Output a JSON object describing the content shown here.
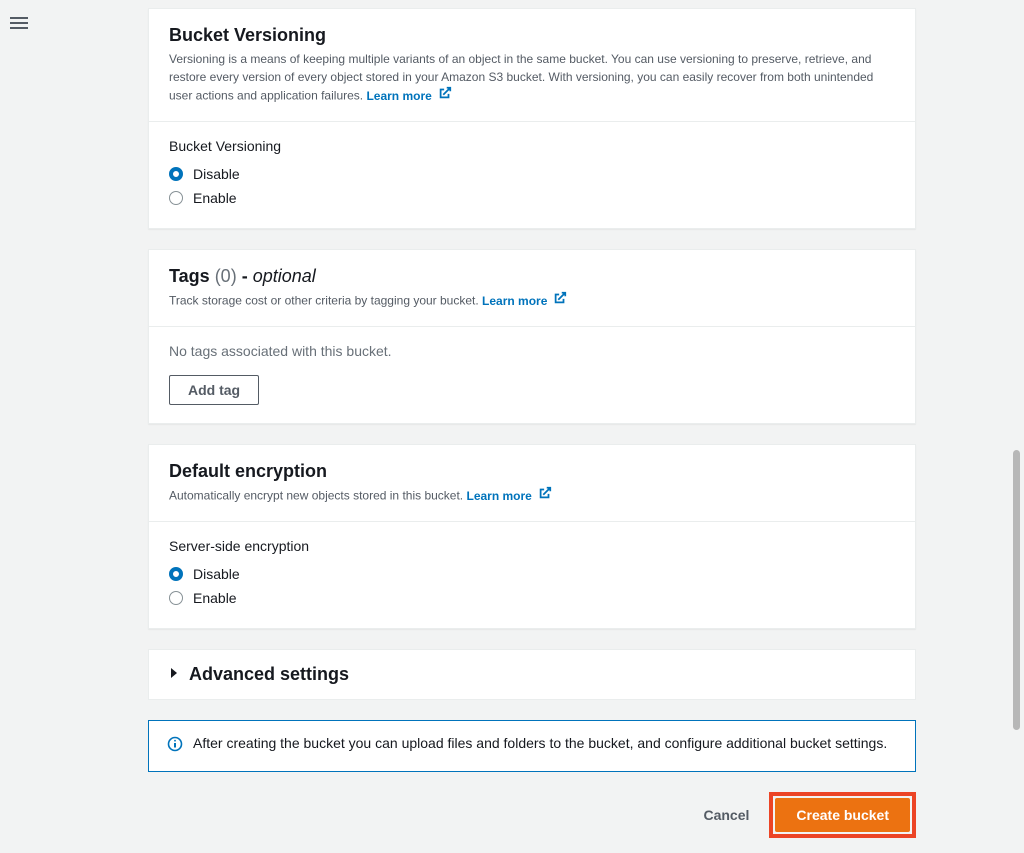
{
  "versioning": {
    "title": "Bucket Versioning",
    "description": "Versioning is a means of keeping multiple variants of an object in the same bucket. You can use versioning to preserve, retrieve, and restore every version of every object stored in your Amazon S3 bucket. With versioning, you can easily recover from both unintended user actions and application failures. ",
    "learn_more": "Learn more",
    "field_label": "Bucket Versioning",
    "option_disable": "Disable",
    "option_enable": "Enable"
  },
  "tags": {
    "title_prefix": "Tags ",
    "count": "(0)",
    "dash": " - ",
    "optional": "optional",
    "description": "Track storage cost or other criteria by tagging your bucket. ",
    "learn_more": "Learn more",
    "empty": "No tags associated with this bucket.",
    "add_btn": "Add tag"
  },
  "encryption": {
    "title": "Default encryption",
    "description": "Automatically encrypt new objects stored in this bucket. ",
    "learn_more": "Learn more",
    "field_label": "Server-side encryption",
    "option_disable": "Disable",
    "option_enable": "Enable"
  },
  "advanced": {
    "title": "Advanced settings"
  },
  "info": {
    "text": "After creating the bucket you can upload files and folders to the bucket, and configure additional bucket settings."
  },
  "actions": {
    "cancel": "Cancel",
    "create": "Create bucket"
  }
}
